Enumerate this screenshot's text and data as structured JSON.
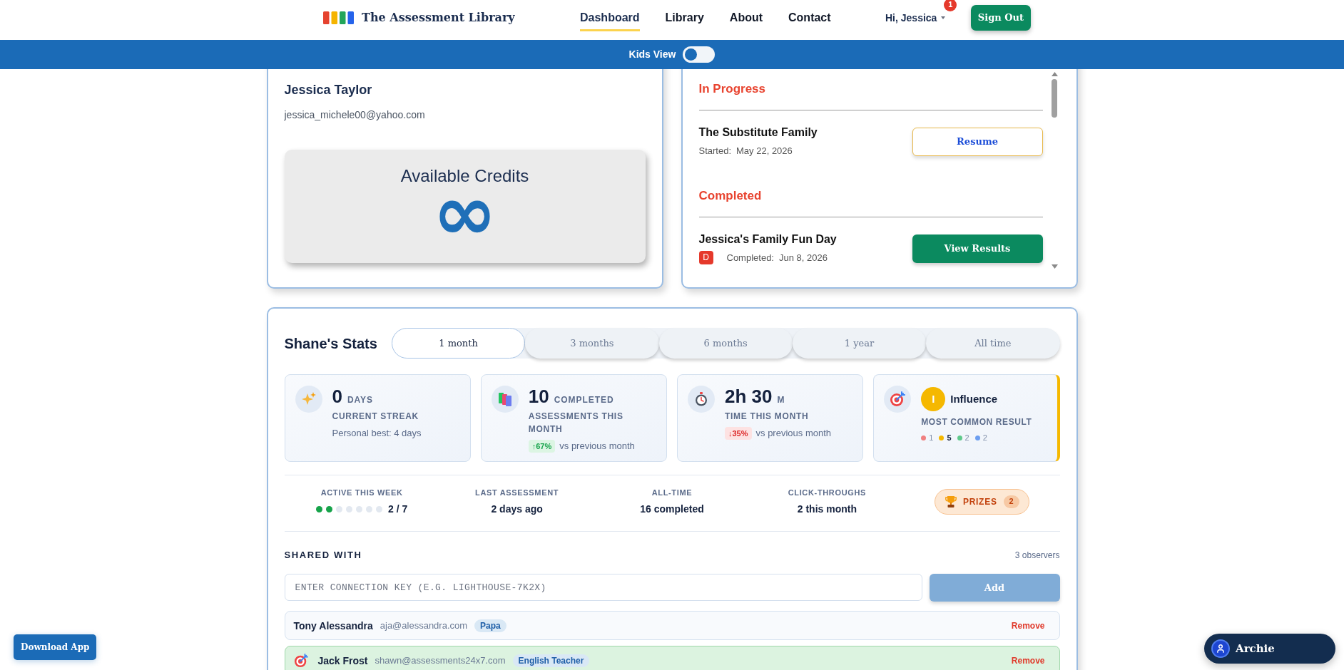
{
  "header": {
    "logo": "The Assessment Library",
    "nav": [
      {
        "label": "Dashboard",
        "selected": true
      },
      {
        "label": "Library",
        "selected": false
      },
      {
        "label": "About",
        "selected": false
      },
      {
        "label": "Contact",
        "selected": false
      }
    ],
    "user_menu": {
      "label": "Hi, Jessica",
      "badge": "1"
    },
    "sign_out": "Sign Out"
  },
  "kids_view": {
    "label": "Kids View",
    "on": false
  },
  "profile": {
    "name": "Jessica Taylor",
    "email": "jessica_michele00@yahoo.com",
    "credits": {
      "title": "Available Credits",
      "value": "∞"
    }
  },
  "assessments": [
    {
      "title": "In Progress",
      "items": [
        {
          "name": "The Substitute Family",
          "status": "Started:",
          "date": "May 22, 2026",
          "action": "Resume",
          "kind": "resume"
        }
      ]
    },
    {
      "title": "Completed",
      "items": [
        {
          "name": "Jessica's Family Fun Day",
          "grade": "D",
          "status": "Completed:",
          "date": "Jun 8, 2026",
          "action": "View Results",
          "kind": "results"
        }
      ]
    }
  ],
  "stats": {
    "title": "Shane's Stats",
    "tabs": [
      {
        "label": "1 month",
        "selected": true
      },
      {
        "label": "3 months",
        "selected": false
      },
      {
        "label": "6 months",
        "selected": false
      },
      {
        "label": "1 year",
        "selected": false
      },
      {
        "label": "All time",
        "selected": false
      }
    ],
    "cards": [
      {
        "kind": "streak",
        "value": "0",
        "unit": "DAYS",
        "label": "CURRENT STREAK",
        "note": "Personal best: 4 days"
      },
      {
        "kind": "completed",
        "value": "10",
        "unit": "COMPLETED",
        "label": "ASSESSMENTS THIS MONTH",
        "change": {
          "text": "↑67%",
          "positive": true
        },
        "note": "vs previous month"
      },
      {
        "kind": "time",
        "value": "2h 30",
        "unit": "M",
        "label": "TIME THIS MONTH",
        "change": {
          "text": "↓35%",
          "positive": false
        },
        "note": "vs previous month"
      },
      {
        "kind": "result",
        "badge": "I",
        "value": "Influence",
        "label": "MOST COMMON RESULT",
        "legend": [
          {
            "count": "1",
            "color": "#f08080",
            "highlighted": false
          },
          {
            "count": "5",
            "color": "#f5b800",
            "highlighted": true
          },
          {
            "count": "2",
            "color": "#5fc98b",
            "highlighted": false
          },
          {
            "count": "2",
            "color": "#6c9ef0",
            "highlighted": false
          }
        ]
      }
    ],
    "summary": [
      {
        "kind": "week",
        "label": "ACTIVE THIS WEEK",
        "days": [
          {
            "active": true
          },
          {
            "active": true
          },
          {
            "active": false
          },
          {
            "active": false
          },
          {
            "active": false
          },
          {
            "active": false
          },
          {
            "active": false
          }
        ],
        "value": "2 / 7"
      },
      {
        "kind": "text",
        "label": "LAST ASSESSMENT",
        "value": "2 days ago"
      },
      {
        "kind": "text",
        "label": "ALL-TIME",
        "value": "16 completed"
      },
      {
        "kind": "text",
        "label": "CLICK-THROUGHS",
        "value": "2 this month"
      }
    ],
    "prizes": {
      "label": "PRIZES",
      "count": "2"
    }
  },
  "shared": {
    "title": "SHARED WITH",
    "count": "3 observers",
    "placeholder": "ENTER CONNECTION KEY (E.G. LIGHTHOUSE-7K2X)",
    "add": {
      "label": "Add",
      "disabled": true
    },
    "observers": [
      {
        "name": "Tony Alessandra",
        "email": "aja@alessandra.com",
        "role": "Papa",
        "highlighted": false,
        "action": "Remove"
      },
      {
        "name": "Jack Frost",
        "email": "shawn@assessments24x7.com",
        "role": "English Teacher",
        "highlighted": true,
        "action": "Remove"
      }
    ]
  },
  "floating": {
    "download": "Download App",
    "assistant": "Archie"
  }
}
